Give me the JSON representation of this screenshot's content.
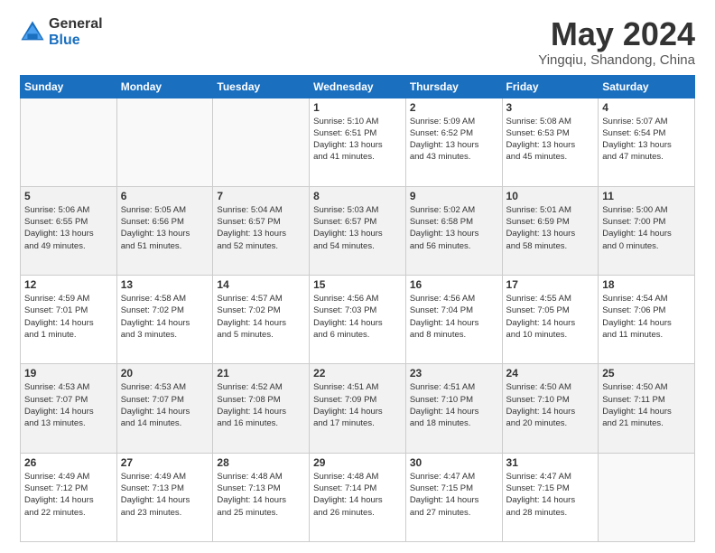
{
  "header": {
    "logo_general": "General",
    "logo_blue": "Blue",
    "main_title": "May 2024",
    "subtitle": "Yingqiu, Shandong, China"
  },
  "days_of_week": [
    "Sunday",
    "Monday",
    "Tuesday",
    "Wednesday",
    "Thursday",
    "Friday",
    "Saturday"
  ],
  "weeks": [
    [
      {
        "day": "",
        "info": ""
      },
      {
        "day": "",
        "info": ""
      },
      {
        "day": "",
        "info": ""
      },
      {
        "day": "1",
        "info": "Sunrise: 5:10 AM\nSunset: 6:51 PM\nDaylight: 13 hours\nand 41 minutes."
      },
      {
        "day": "2",
        "info": "Sunrise: 5:09 AM\nSunset: 6:52 PM\nDaylight: 13 hours\nand 43 minutes."
      },
      {
        "day": "3",
        "info": "Sunrise: 5:08 AM\nSunset: 6:53 PM\nDaylight: 13 hours\nand 45 minutes."
      },
      {
        "day": "4",
        "info": "Sunrise: 5:07 AM\nSunset: 6:54 PM\nDaylight: 13 hours\nand 47 minutes."
      }
    ],
    [
      {
        "day": "5",
        "info": "Sunrise: 5:06 AM\nSunset: 6:55 PM\nDaylight: 13 hours\nand 49 minutes."
      },
      {
        "day": "6",
        "info": "Sunrise: 5:05 AM\nSunset: 6:56 PM\nDaylight: 13 hours\nand 51 minutes."
      },
      {
        "day": "7",
        "info": "Sunrise: 5:04 AM\nSunset: 6:57 PM\nDaylight: 13 hours\nand 52 minutes."
      },
      {
        "day": "8",
        "info": "Sunrise: 5:03 AM\nSunset: 6:57 PM\nDaylight: 13 hours\nand 54 minutes."
      },
      {
        "day": "9",
        "info": "Sunrise: 5:02 AM\nSunset: 6:58 PM\nDaylight: 13 hours\nand 56 minutes."
      },
      {
        "day": "10",
        "info": "Sunrise: 5:01 AM\nSunset: 6:59 PM\nDaylight: 13 hours\nand 58 minutes."
      },
      {
        "day": "11",
        "info": "Sunrise: 5:00 AM\nSunset: 7:00 PM\nDaylight: 14 hours\nand 0 minutes."
      }
    ],
    [
      {
        "day": "12",
        "info": "Sunrise: 4:59 AM\nSunset: 7:01 PM\nDaylight: 14 hours\nand 1 minute."
      },
      {
        "day": "13",
        "info": "Sunrise: 4:58 AM\nSunset: 7:02 PM\nDaylight: 14 hours\nand 3 minutes."
      },
      {
        "day": "14",
        "info": "Sunrise: 4:57 AM\nSunset: 7:02 PM\nDaylight: 14 hours\nand 5 minutes."
      },
      {
        "day": "15",
        "info": "Sunrise: 4:56 AM\nSunset: 7:03 PM\nDaylight: 14 hours\nand 6 minutes."
      },
      {
        "day": "16",
        "info": "Sunrise: 4:56 AM\nSunset: 7:04 PM\nDaylight: 14 hours\nand 8 minutes."
      },
      {
        "day": "17",
        "info": "Sunrise: 4:55 AM\nSunset: 7:05 PM\nDaylight: 14 hours\nand 10 minutes."
      },
      {
        "day": "18",
        "info": "Sunrise: 4:54 AM\nSunset: 7:06 PM\nDaylight: 14 hours\nand 11 minutes."
      }
    ],
    [
      {
        "day": "19",
        "info": "Sunrise: 4:53 AM\nSunset: 7:07 PM\nDaylight: 14 hours\nand 13 minutes."
      },
      {
        "day": "20",
        "info": "Sunrise: 4:53 AM\nSunset: 7:07 PM\nDaylight: 14 hours\nand 14 minutes."
      },
      {
        "day": "21",
        "info": "Sunrise: 4:52 AM\nSunset: 7:08 PM\nDaylight: 14 hours\nand 16 minutes."
      },
      {
        "day": "22",
        "info": "Sunrise: 4:51 AM\nSunset: 7:09 PM\nDaylight: 14 hours\nand 17 minutes."
      },
      {
        "day": "23",
        "info": "Sunrise: 4:51 AM\nSunset: 7:10 PM\nDaylight: 14 hours\nand 18 minutes."
      },
      {
        "day": "24",
        "info": "Sunrise: 4:50 AM\nSunset: 7:10 PM\nDaylight: 14 hours\nand 20 minutes."
      },
      {
        "day": "25",
        "info": "Sunrise: 4:50 AM\nSunset: 7:11 PM\nDaylight: 14 hours\nand 21 minutes."
      }
    ],
    [
      {
        "day": "26",
        "info": "Sunrise: 4:49 AM\nSunset: 7:12 PM\nDaylight: 14 hours\nand 22 minutes."
      },
      {
        "day": "27",
        "info": "Sunrise: 4:49 AM\nSunset: 7:13 PM\nDaylight: 14 hours\nand 23 minutes."
      },
      {
        "day": "28",
        "info": "Sunrise: 4:48 AM\nSunset: 7:13 PM\nDaylight: 14 hours\nand 25 minutes."
      },
      {
        "day": "29",
        "info": "Sunrise: 4:48 AM\nSunset: 7:14 PM\nDaylight: 14 hours\nand 26 minutes."
      },
      {
        "day": "30",
        "info": "Sunrise: 4:47 AM\nSunset: 7:15 PM\nDaylight: 14 hours\nand 27 minutes."
      },
      {
        "day": "31",
        "info": "Sunrise: 4:47 AM\nSunset: 7:15 PM\nDaylight: 14 hours\nand 28 minutes."
      },
      {
        "day": "",
        "info": ""
      }
    ]
  ]
}
